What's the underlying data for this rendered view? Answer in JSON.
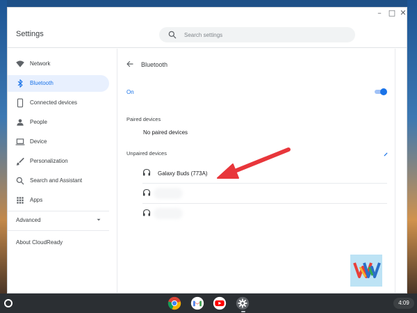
{
  "window": {
    "title": "Settings",
    "controls": {
      "minimize": "–",
      "maximize": "□",
      "close": "✕"
    }
  },
  "search": {
    "placeholder": "Search settings"
  },
  "sidebar": {
    "items": [
      {
        "label": "Network",
        "icon": "wifi-icon"
      },
      {
        "label": "Bluetooth",
        "icon": "bluetooth-icon",
        "active": true
      },
      {
        "label": "Connected devices",
        "icon": "phone-icon"
      },
      {
        "label": "People",
        "icon": "person-icon"
      },
      {
        "label": "Device",
        "icon": "laptop-icon"
      },
      {
        "label": "Personalization",
        "icon": "brush-icon"
      },
      {
        "label": "Search and Assistant",
        "icon": "search-icon"
      },
      {
        "label": "Apps",
        "icon": "apps-grid-icon"
      }
    ],
    "advanced_label": "Advanced",
    "about_label": "About CloudReady"
  },
  "bluetooth": {
    "title": "Bluetooth",
    "state_label": "On",
    "enabled": true,
    "paired_heading": "Paired devices",
    "no_paired_text": "No paired devices",
    "unpaired_heading": "Unpaired devices",
    "unpaired_devices": [
      {
        "name": "Galaxy Buds (773A)",
        "icon": "headphones-icon"
      },
      {
        "name": "",
        "icon": "headphones-icon",
        "obscured": true
      },
      {
        "name": "",
        "icon": "headphones-icon",
        "obscured": true
      }
    ]
  },
  "colors": {
    "accent": "#1a73e8",
    "active_bg": "#e8f0fe",
    "arrow": "#e8363b",
    "shelf": "#2b2f33"
  },
  "shelf": {
    "apps": [
      "chrome-icon",
      "gmail-icon",
      "youtube-icon",
      "settings-icon"
    ],
    "clock": "4:09"
  }
}
